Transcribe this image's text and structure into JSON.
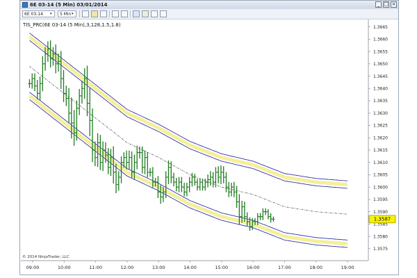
{
  "window": {
    "title": "6E 03-14 (5 Min)  03/01/2014",
    "controls": {
      "minimize": "_",
      "maximize": "□",
      "close": "×"
    }
  },
  "toolbar": {
    "instrument": "6E 03-14",
    "interval": "5 Min",
    "icons": [
      "bars-type-icon",
      "pencil-draw-icon",
      "magnify-icon",
      "crosshair-icon",
      "data-box-icon",
      "properties-icon",
      "strategy-icon",
      "indicators-icon",
      "chart-trader-icon"
    ]
  },
  "chart": {
    "indicator_label": "TIS_PRC(6E 03-14 (5 Min),3,128,1.5,1.8)",
    "copyright": "© 2014 NinjaTrader, LLC",
    "last_price": "1.3587",
    "colors": {
      "price": "#1f7a1f",
      "band_outer": "#2f34a8",
      "band_fill": "#f6ef9a",
      "midline": "#555555",
      "marker": "#f7f20a"
    }
  },
  "chart_data": {
    "type": "line",
    "title": "",
    "xlabel": "",
    "ylabel": "",
    "x_ticks": [
      "09:00",
      "10:00",
      "11:00",
      "12:00",
      "13:00",
      "14:00",
      "15:00",
      "16:00",
      "17:00",
      "18:00",
      "19:00"
    ],
    "y_ticks": [
      "1.3575",
      "1.3580",
      "1.3585",
      "1.3590",
      "1.3595",
      "1.3600",
      "1.3605",
      "1.3610",
      "1.3615",
      "1.3620",
      "1.3625",
      "1.3630",
      "1.3635",
      "1.3640",
      "1.3645",
      "1.3650",
      "1.3655",
      "1.3660",
      "1.3665"
    ],
    "ylim": [
      1.3571,
      1.3668
    ],
    "x_hours": [
      9.0,
      19.0
    ],
    "grid": false,
    "series": [
      {
        "type": "ohlc",
        "x_start": 8.9,
        "x_step": 0.0833,
        "close": [
          1.3642,
          1.3644,
          1.3641,
          1.3638,
          1.3642,
          1.365,
          1.3654,
          1.3656,
          1.3652,
          1.3654,
          1.365,
          1.3651,
          1.3644,
          1.3638,
          1.3636,
          1.363,
          1.3626,
          1.3622,
          1.3632,
          1.3637,
          1.364,
          1.3644,
          1.3634,
          1.3627,
          1.3615,
          1.3612,
          1.3618,
          1.361,
          1.3615,
          1.3613,
          1.3608,
          1.3612,
          1.3606,
          1.3601,
          1.3604,
          1.361,
          1.3612,
          1.361,
          1.3612,
          1.3606,
          1.361,
          1.3614,
          1.3614,
          1.3608,
          1.3612,
          1.3606,
          1.3606,
          1.3602,
          1.3602,
          1.3598,
          1.3596,
          1.3598,
          1.3604,
          1.3608,
          1.3604,
          1.3602,
          1.36,
          1.3602,
          1.36,
          1.3598,
          1.36,
          1.3602,
          1.3604,
          1.3602,
          1.36,
          1.3602,
          1.36,
          1.3602,
          1.3603,
          1.3604,
          1.3602,
          1.3606,
          1.3604,
          1.3606,
          1.3604,
          1.36,
          1.3598,
          1.36,
          1.3598,
          1.3594,
          1.3588,
          1.3592,
          1.3588,
          1.3586,
          1.3584,
          1.3586,
          1.3586,
          1.3588,
          1.3588,
          1.359,
          1.359,
          1.3588,
          1.3587,
          1.3587
        ],
        "range": [
          0.0005,
          0.0006,
          0.0006,
          0.0007,
          0.0008,
          0.0009,
          0.0008,
          0.0009,
          0.001,
          0.0008,
          0.0011,
          0.0009,
          0.0012,
          0.001,
          0.0009,
          0.0012,
          0.0018,
          0.0015,
          0.0009,
          0.0008,
          0.0009,
          0.0012,
          0.0015,
          0.0018,
          0.0014,
          0.001,
          0.0011,
          0.0009,
          0.001,
          0.0009,
          0.0008,
          0.001,
          0.0013,
          0.001,
          0.0007,
          0.0007,
          0.0006,
          0.0008,
          0.0008,
          0.0007,
          0.0009,
          0.0008,
          0.0007,
          0.0007,
          0.0008,
          0.0006,
          0.0005,
          0.0006,
          0.0005,
          0.0007,
          0.0008,
          0.0006,
          0.0007,
          0.0008,
          0.0007,
          0.0005,
          0.0005,
          0.0006,
          0.0006,
          0.0005,
          0.0005,
          0.0006,
          0.0005,
          0.0004,
          0.0004,
          0.0004,
          0.0004,
          0.0004,
          0.0006,
          0.0007,
          0.0006,
          0.0006,
          0.0007,
          0.0008,
          0.0007,
          0.0006,
          0.0006,
          0.0005,
          0.0006,
          0.0007,
          0.0009,
          0.0007,
          0.0006,
          0.0005,
          0.0005,
          0.0004,
          0.0004,
          0.0004,
          0.0004,
          0.0004,
          0.0004,
          0.0003,
          0.0004,
          0.0003
        ]
      },
      {
        "type": "channel",
        "mid": [
          [
            8.9,
            1.3649
          ],
          [
            10.0,
            1.3638
          ],
          [
            11.0,
            1.3628
          ],
          [
            12.0,
            1.3618
          ],
          [
            13.0,
            1.3612
          ],
          [
            14.0,
            1.3605
          ],
          [
            15.0,
            1.36
          ],
          [
            16.0,
            1.3597
          ],
          [
            17.0,
            1.3592
          ],
          [
            18.0,
            1.359
          ],
          [
            19.0,
            1.3589
          ]
        ],
        "inner_offset": 0.00105,
        "outer_offset": 0.00135
      }
    ]
  }
}
